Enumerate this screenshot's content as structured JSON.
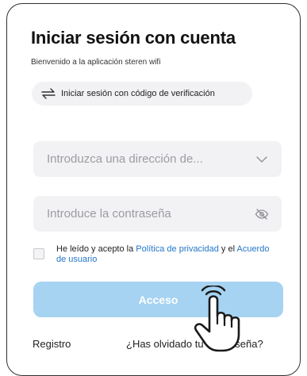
{
  "header": {
    "title": "Iniciar sesión con cuenta",
    "subtitle": "Bienvenido a la aplicación steren wifi"
  },
  "code_login": {
    "label": "Iniciar sesión con código de verificación",
    "icon": "swap-arrows-icon"
  },
  "email": {
    "placeholder": "Introduzca una dirección de...",
    "value": "",
    "icon": "chevron-down-icon"
  },
  "password": {
    "placeholder": "Introduce la contraseña",
    "value": "",
    "icon": "eye-off-icon"
  },
  "agreement": {
    "checked": false,
    "prefix": "He leído y acepto la ",
    "privacy_link": "Política de privacidad",
    "middle": " y el ",
    "terms_link": "Acuerdo de usuario"
  },
  "login_button": {
    "label": "Acceso"
  },
  "footer": {
    "register": "Registro",
    "forgot": "¿Has olvidado tu contraseña?"
  },
  "colors": {
    "button": "#a6d3f2",
    "link": "#2477c9",
    "field_bg": "#f2f2f4"
  }
}
